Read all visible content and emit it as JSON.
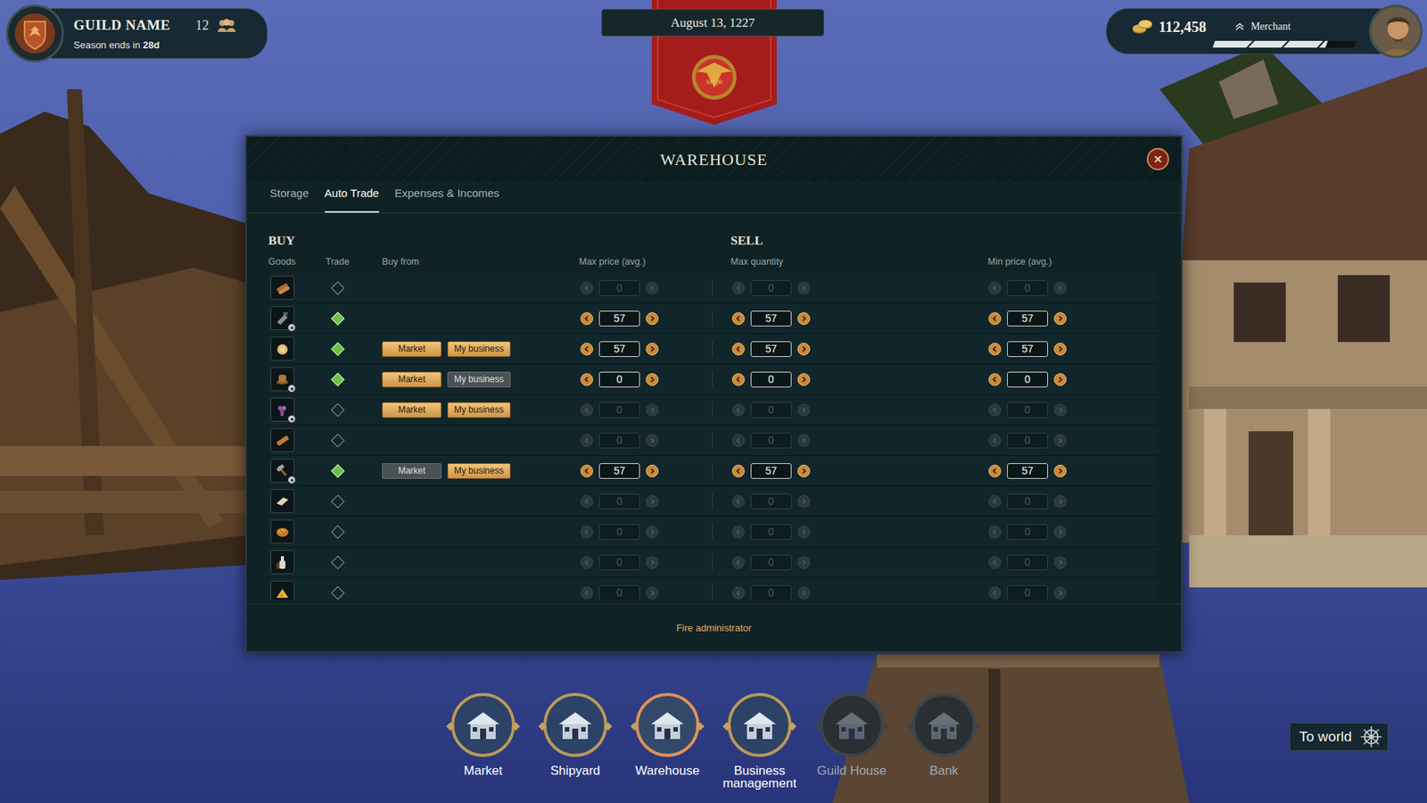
{
  "guild": {
    "name": "GUILD NAME",
    "members": "12",
    "season_label": "Season ends in",
    "season_remaining": "28d"
  },
  "date": "August 13, 1227",
  "banner": {
    "emblem_text": "SPQR"
  },
  "player": {
    "gold": "112,458",
    "rank": "Merchant",
    "rank_level": 0.8
  },
  "window": {
    "title": "WAREHOUSE"
  },
  "tabs": [
    {
      "label": "Storage",
      "selected": false
    },
    {
      "label": "Auto Trade",
      "selected": true
    },
    {
      "label": "Expenses & Incomes",
      "selected": false
    }
  ],
  "buy": {
    "title": "BUY",
    "columns": [
      "Goods",
      "Trade",
      "Buy from",
      "Max price (avg.)"
    ]
  },
  "sell": {
    "title": "SELL",
    "columns": [
      "Max quantity",
      "Min price (avg.)"
    ]
  },
  "rows": [
    {
      "badge": false,
      "trade": false,
      "buy_from": [],
      "max_price": "0",
      "max_quantity": "0",
      "min_price": "0"
    },
    {
      "badge": true,
      "trade": true,
      "buy_from": [],
      "max_price": "57",
      "max_quantity": "57",
      "min_price": "57"
    },
    {
      "badge": false,
      "trade": true,
      "buy_from": [
        {
          "label": "Market",
          "active": true
        },
        {
          "label": "My business",
          "active": true
        }
      ],
      "max_price": "57",
      "max_quantity": "57",
      "min_price": "57"
    },
    {
      "badge": true,
      "trade": true,
      "buy_from": [
        {
          "label": "Market",
          "active": true
        },
        {
          "label": "My business",
          "active": false
        }
      ],
      "max_price": "0",
      "max_quantity": "0",
      "min_price": "0"
    },
    {
      "badge": true,
      "trade": false,
      "buy_from": [
        {
          "label": "Market",
          "active": true
        },
        {
          "label": "My business",
          "active": true
        }
      ],
      "max_price": "0",
      "max_quantity": "0",
      "min_price": "0"
    },
    {
      "badge": false,
      "trade": false,
      "buy_from": [],
      "max_price": "0",
      "max_quantity": "0",
      "min_price": "0"
    },
    {
      "badge": true,
      "trade": true,
      "buy_from": [
        {
          "label": "Market",
          "active": false
        },
        {
          "label": "My business",
          "active": true
        }
      ],
      "max_price": "57",
      "max_quantity": "57",
      "min_price": "57"
    },
    {
      "badge": false,
      "trade": false,
      "buy_from": [],
      "max_price": "0",
      "max_quantity": "0",
      "min_price": "0"
    },
    {
      "badge": false,
      "trade": false,
      "buy_from": [],
      "max_price": "0",
      "max_quantity": "0",
      "min_price": "0"
    },
    {
      "badge": false,
      "trade": false,
      "buy_from": [],
      "max_price": "0",
      "max_quantity": "0",
      "min_price": "0"
    },
    {
      "badge": false,
      "trade": false,
      "buy_from": [],
      "max_price": "0",
      "max_quantity": "0",
      "min_price": "0"
    }
  ],
  "footer_action": "Fire administrator",
  "nav": [
    {
      "label": "Market",
      "selected": false,
      "disabled": false
    },
    {
      "label": "Shipyard",
      "selected": false,
      "disabled": false
    },
    {
      "label": "Warehouse",
      "selected": true,
      "disabled": false
    },
    {
      "label": "Business management",
      "selected": false,
      "disabled": false
    },
    {
      "label": "Guild House",
      "selected": false,
      "disabled": true
    },
    {
      "label": "Bank",
      "selected": false,
      "disabled": true
    }
  ],
  "to_world": "To world"
}
